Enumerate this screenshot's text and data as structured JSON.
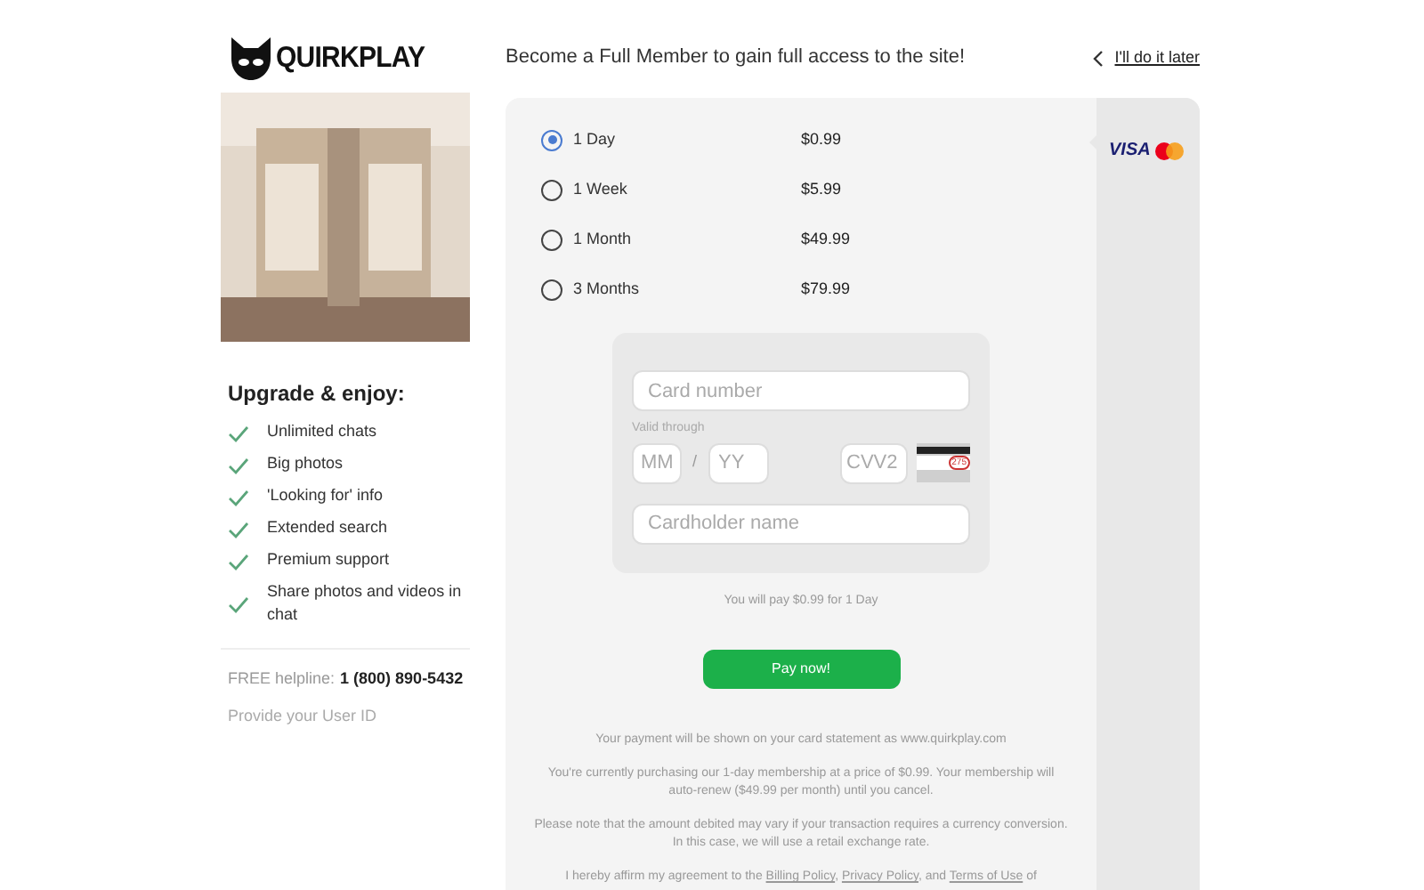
{
  "logo": {
    "text": "QUIRKPLAY"
  },
  "header": {
    "title": "Become a Full Member to gain full access to the site!",
    "later_link": "I'll do it later"
  },
  "sidebar": {
    "heading": "Upgrade & enjoy:",
    "features": [
      "Unlimited chats",
      "Big photos",
      "'Looking for' info",
      "Extended search",
      "Premium support",
      "Share photos and videos in chat"
    ],
    "helpline_label": "FREE helpline:",
    "helpline_number": "1 (800) 890-5432",
    "user_id_label": "Provide your User ID"
  },
  "plans": [
    {
      "label": "1 Day",
      "price": "$0.99",
      "selected": true
    },
    {
      "label": "1 Week",
      "price": "$5.99",
      "selected": false
    },
    {
      "label": "1 Month",
      "price": "$49.99",
      "selected": false
    },
    {
      "label": "3 Months",
      "price": "$79.99",
      "selected": false
    }
  ],
  "card_form": {
    "card_number": {
      "placeholder": "Card number"
    },
    "valid_label": "Valid through",
    "month": {
      "placeholder": "MM"
    },
    "separator": "/",
    "year": {
      "placeholder": "YY"
    },
    "cvv": {
      "placeholder": "CVV2"
    },
    "cvv_hint": "275",
    "holder": {
      "placeholder": "Cardholder name"
    }
  },
  "summary": "You will pay $0.99 for 1 Day",
  "pay_button": "Pay now!",
  "notes": [
    "Your payment will be shown on your card statement as www.quirkplay.com",
    "You're currently purchasing our 1-day membership at a price of $0.99. Your membership will auto-renew ($49.99 per month) until you cancel.",
    "Please note that the amount debited may vary if your transaction requires a currency conversion. In this case, we will use a retail exchange rate."
  ],
  "agreement": [
    {
      "kind": "text",
      "text": "I hereby affirm my agreement to the "
    },
    {
      "kind": "link",
      "text": "Billing Policy"
    },
    {
      "kind": "text",
      "text": ", "
    },
    {
      "kind": "link",
      "text": "Privacy Policy"
    },
    {
      "kind": "text",
      "text": ", and "
    },
    {
      "kind": "link",
      "text": "Terms of Use"
    },
    {
      "kind": "text",
      "text": " of"
    }
  ],
  "payment_logos": {
    "visa": "VISA"
  }
}
